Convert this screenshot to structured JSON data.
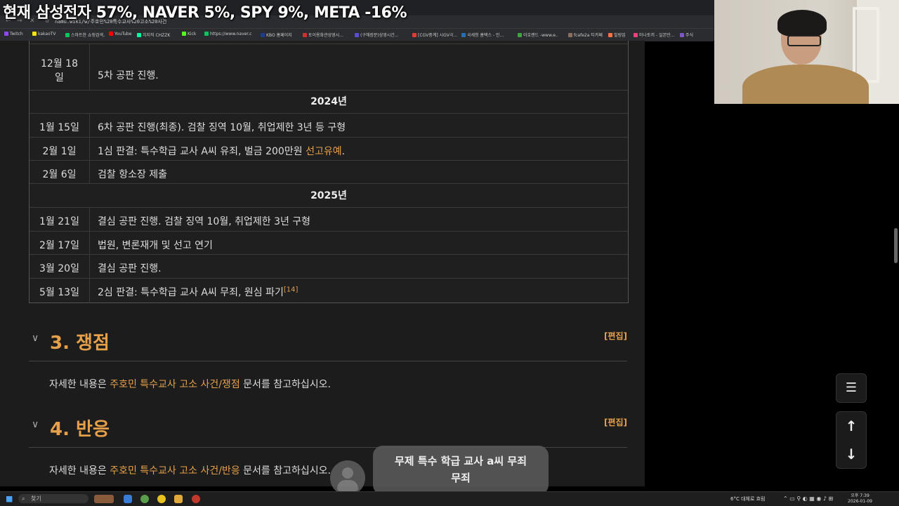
{
  "overlay": {
    "banner": "현재 삼성전자 57%, NAVER 5%, SPY 9%, META -16%"
  },
  "browser": {
    "url": "namu.wiki/w/주호민%20특수교사%20고소%20사건",
    "bookmarks": [
      {
        "label": "Twitch",
        "color": "#9146ff"
      },
      {
        "label": "kakaoTV",
        "color": "#f7e600"
      },
      {
        "label": "스마트한 쇼핑검색,",
        "color": "#03c75a"
      },
      {
        "label": "YouTube",
        "color": "#ff0000"
      },
      {
        "label": "치지직 CHZZK",
        "color": "#00ffa3"
      },
      {
        "label": "Kick",
        "color": "#53fc18"
      },
      {
        "label": "https://www.naver.c",
        "color": "#03c75a"
      },
      {
        "label": "KBO 홈페이지",
        "color": "#1a3d8f"
      },
      {
        "label": "토이용화관상영시...",
        "color": "#d32f2f"
      },
      {
        "label": "(구해장문)상영시간...",
        "color": "#5a4fcf"
      },
      {
        "label": "[CGV중계] 시GV극...",
        "color": "#e53935"
      },
      {
        "label": "국세청 홈택스 - 인...",
        "color": "#2b6cb0"
      },
      {
        "label": "이호랜드 -www.e..",
        "color": "#43a047"
      },
      {
        "label": "fcafe2a 티카페",
        "color": "#8d6e63"
      },
      {
        "label": "빌링업",
        "color": "#ff7043"
      },
      {
        "label": "마나토끼 - 일본만...",
        "color": "#ec407a"
      },
      {
        "label": "주식",
        "color": "#7e57c2"
      }
    ]
  },
  "timeline": {
    "partial_top_date": "일",
    "rows": [
      {
        "type": "entry",
        "date_line1": "12월 18",
        "date_line2": "일",
        "desc": "5차 공판 진행."
      },
      {
        "type": "year",
        "label": "2024년"
      },
      {
        "type": "entry",
        "date": "1월 15일",
        "desc": "6차 공판 진행(최종). 검찰 징역 10월, 취업제한 3년 등 구형"
      },
      {
        "type": "entry",
        "date": "2월 1일",
        "desc_before": "1심 판결: 특수학급 교사 A씨 유죄, 벌금 200만원 ",
        "desc_link": "선고유예",
        "desc_after": "."
      },
      {
        "type": "entry",
        "date": "2월 6일",
        "desc": "검찰 항소장 제출"
      },
      {
        "type": "year",
        "label": "2025년"
      },
      {
        "type": "entry",
        "date": "1월 21일",
        "desc": "결심 공판 진행. 검찰 징역 10월, 취업제한 3년 구형"
      },
      {
        "type": "entry",
        "date": "2월 17일",
        "desc": "법원, 변론재개 및 선고 연기"
      },
      {
        "type": "entry",
        "date": "3월 20일",
        "desc": "결심 공판 진행."
      },
      {
        "type": "entry",
        "date": "5월 13일",
        "desc": "2심 판결: 특수학급 교사 A씨 무죄, 원심 파기",
        "footnote": "[14]"
      }
    ]
  },
  "sections": [
    {
      "number_title": "3. 쟁점",
      "edit": "[편집]",
      "para_before": "자세한 내용은 ",
      "para_link": "주호민 특수교사 고소 사건/쟁점",
      "para_after": " 문서를 참고하십시오."
    },
    {
      "number_title": "4. 반응",
      "edit": "[편집]",
      "para_before": "자세한 내용은 ",
      "para_link": "주호민 특수교사 고소 사건/반응",
      "para_after": " 문서를 참고하십시오."
    }
  ],
  "caption": {
    "line1": "무제 특수 학급 교사 a씨 무죄",
    "line2": "무죄"
  },
  "float_buttons": {
    "toc": "☰",
    "up": "↑",
    "down": "↓"
  },
  "taskbar": {
    "search_label": "찾기",
    "weather": "6°C 대체로 흐림",
    "time": "오후 7:39",
    "date": "2026-01-09"
  },
  "colors": {
    "link": "#e6a04a",
    "page_bg": "#1c1c1c"
  }
}
